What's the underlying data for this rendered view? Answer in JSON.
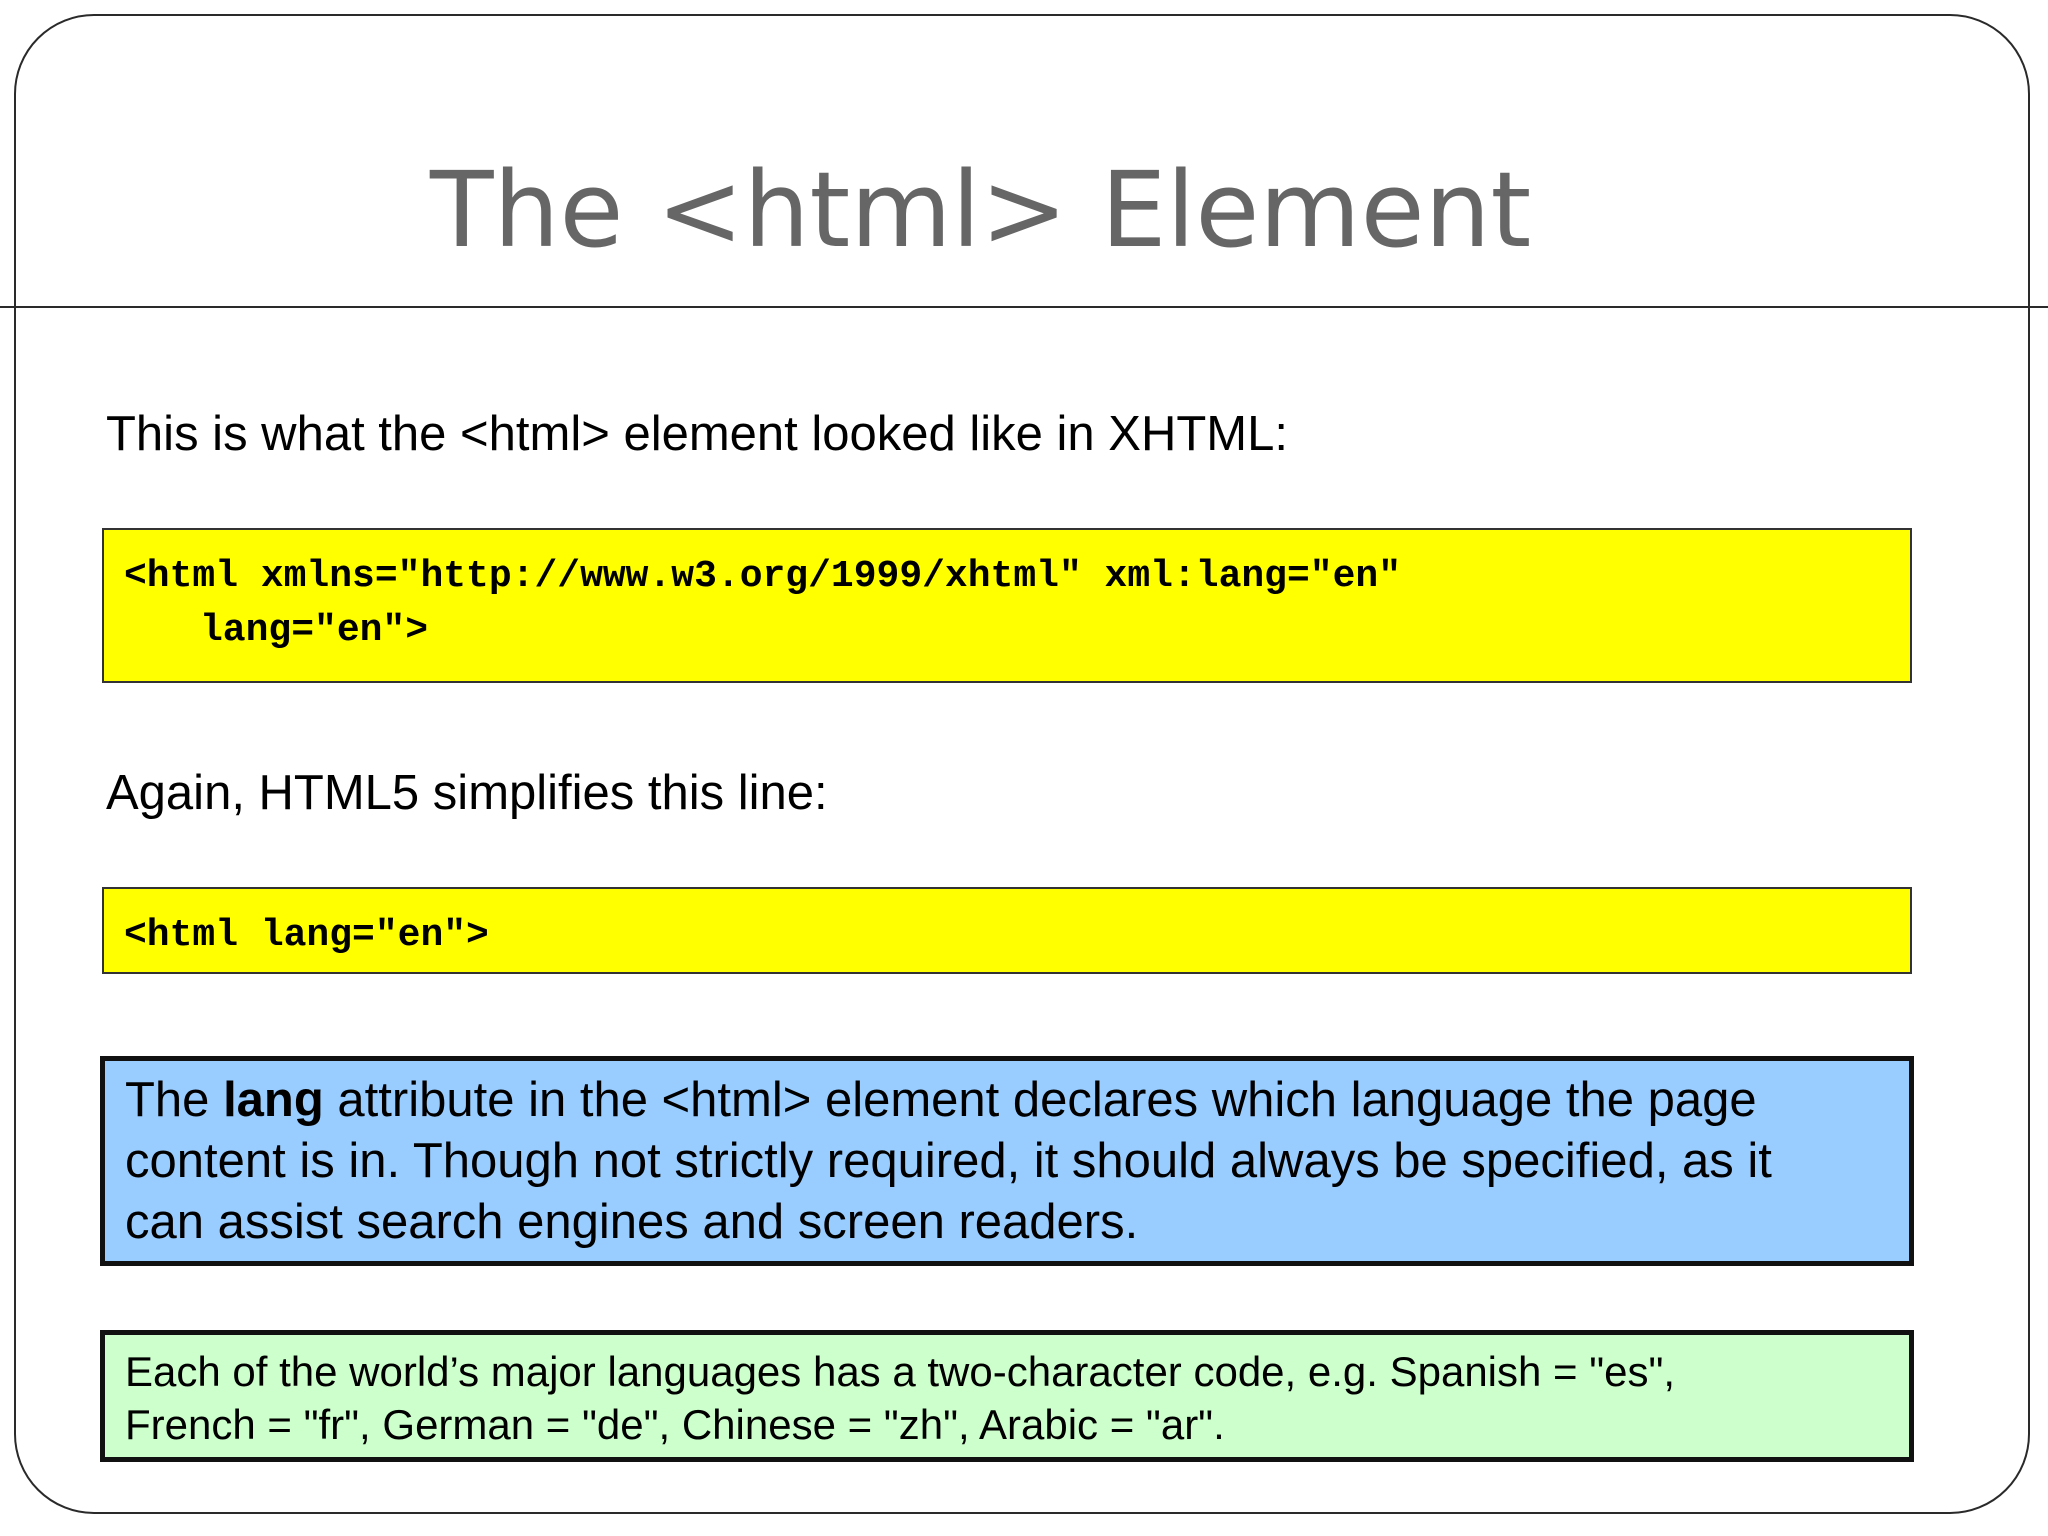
{
  "slide": {
    "title": "The <html> Element",
    "intro_xhtml": "This is what the <html> element looked like in XHTML:",
    "xhtml_code": {
      "line1": "<html xmlns=\"http://www.w3.org/1999/xhtml\" xml:lang=\"en\"",
      "line2": "lang=\"en\">"
    },
    "intro_html5": "Again, HTML5 simplifies this line:",
    "html5_code": {
      "line1": "<html lang=\"en\">"
    },
    "lang_note": {
      "prefix": "The ",
      "keyword": "lang",
      "line1_rest": " attribute in the <html> element declares which language the page",
      "line2": "content is in.  Though not strictly required, it should always be specified, as it",
      "line3": "can assist search engines and screen readers."
    },
    "code_note": {
      "line1": "Each of the world’s major languages has a two-character code, e.g. Spanish = \"es\",",
      "line2": "French = \"fr\", German = \"de\", Chinese = \"zh\", Arabic = \"ar\"."
    },
    "colors": {
      "code_box": "#ffff00",
      "lang_note_box": "#99ccff",
      "code_note_box": "#ccffcc",
      "title": "#666666"
    }
  }
}
